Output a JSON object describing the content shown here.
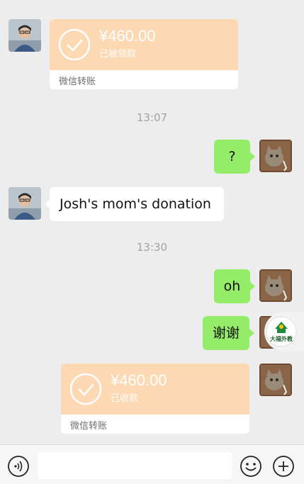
{
  "messages": {
    "transfer1": {
      "amount": "¥460.00",
      "status": "已被领取",
      "footer": "微信转账"
    },
    "time1": "13:07",
    "msg_question": "?",
    "msg_josh": "Josh's mom's donation",
    "time2": "13:30",
    "msg_oh": "oh",
    "msg_thanks": "谢谢",
    "transfer2": {
      "amount": "¥460.00",
      "status": "已收款",
      "footer": "微信转账"
    }
  },
  "floating_badge": {
    "label": "大福外教"
  },
  "colors": {
    "background": "#ededed",
    "bubble_green": "#95ec69",
    "transfer_top": "#fcd9b3",
    "time_text": "#a2a2a2"
  },
  "icons": {
    "voice": "voice-icon",
    "emoji": "emoji-icon",
    "plus": "plus-icon",
    "check": "check-circle-icon"
  }
}
